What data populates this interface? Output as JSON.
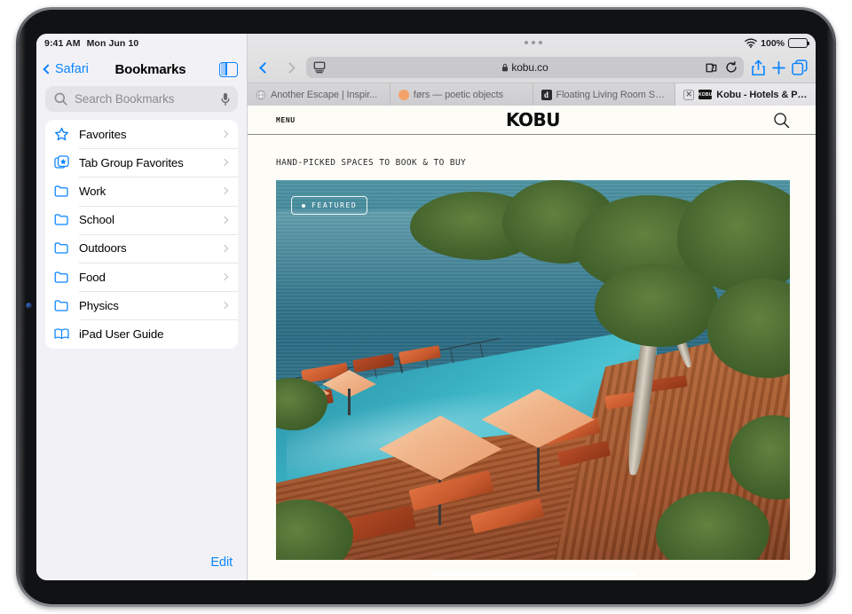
{
  "sidebar": {
    "status": {
      "time": "9:41 AM",
      "date": "Mon Jun 10"
    },
    "back_label": "Safari",
    "title": "Bookmarks",
    "toggle_icon": "sidebar-toggle-icon",
    "search": {
      "placeholder": "Search Bookmarks",
      "icon": "search-icon",
      "mic_icon": "microphone-icon"
    },
    "items": [
      {
        "label": "Favorites",
        "icon": "star-icon",
        "chevron": true
      },
      {
        "label": "Tab Group Favorites",
        "icon": "tab-group-star-icon",
        "chevron": true
      },
      {
        "label": "Work",
        "icon": "folder-icon",
        "chevron": true
      },
      {
        "label": "School",
        "icon": "folder-icon",
        "chevron": true
      },
      {
        "label": "Outdoors",
        "icon": "folder-icon",
        "chevron": true
      },
      {
        "label": "Food",
        "icon": "folder-icon",
        "chevron": true
      },
      {
        "label": "Physics",
        "icon": "folder-icon",
        "chevron": true
      },
      {
        "label": "iPad User Guide",
        "icon": "book-icon",
        "chevron": false
      }
    ],
    "edit_label": "Edit"
  },
  "browser": {
    "status": {
      "wifi_icon": "wifi-icon",
      "battery_percent": "100%",
      "battery_icon": "battery-full-icon"
    },
    "multitask_icon": "multitasking-dots-icon",
    "back_icon": "back-chevron-icon",
    "forward_icon": "forward-chevron-icon",
    "url": {
      "value": "kobu.co",
      "lock_icon": "lock-icon",
      "reader_icon": "reader-view-icon",
      "extension_icon": "extension-puzzle-icon",
      "reload_icon": "reload-icon"
    },
    "share_icon": "share-icon",
    "new_tab_icon": "plus-icon",
    "tabs_overview_icon": "tabs-overview-icon",
    "tabs": [
      {
        "title": "Another Escape | Inspir...",
        "favicon": "globe-favicon",
        "active": false,
        "closable": false
      },
      {
        "title": "førs — poetic objects",
        "favicon": "orange-circle-favicon",
        "active": false,
        "closable": false
      },
      {
        "title": "Floating Living Room Se...",
        "favicon": "dezeen-d-favicon",
        "active": false,
        "closable": false
      },
      {
        "title": "Kobu - Hotels & Propert...",
        "favicon": "kobu-favicon",
        "active": true,
        "closable": true,
        "close_label": "✕"
      }
    ]
  },
  "site": {
    "menu_label": "MENU",
    "logo": "KOBU",
    "search_icon": "site-search-icon",
    "tagline": "HAND-PICKED SPACES TO BOOK & TO BUY",
    "hero": {
      "badge_label": "FEATURED",
      "badge_dot": "bullet-dot",
      "alt": "Aerial view of an infinity pool resort deck with peach umbrellas, orange loungers and trees overlooking a teal ocean"
    }
  },
  "colors": {
    "ios_blue": "#0a84ff",
    "sidebar_bg": "#f2f2f6",
    "page_bg": "#fdfcf7",
    "ocean_teal": "#3f8598",
    "umbrella_peach": "#f0b489",
    "lounger_orange": "#c85a2e",
    "deck_wood": "#a8572c"
  }
}
